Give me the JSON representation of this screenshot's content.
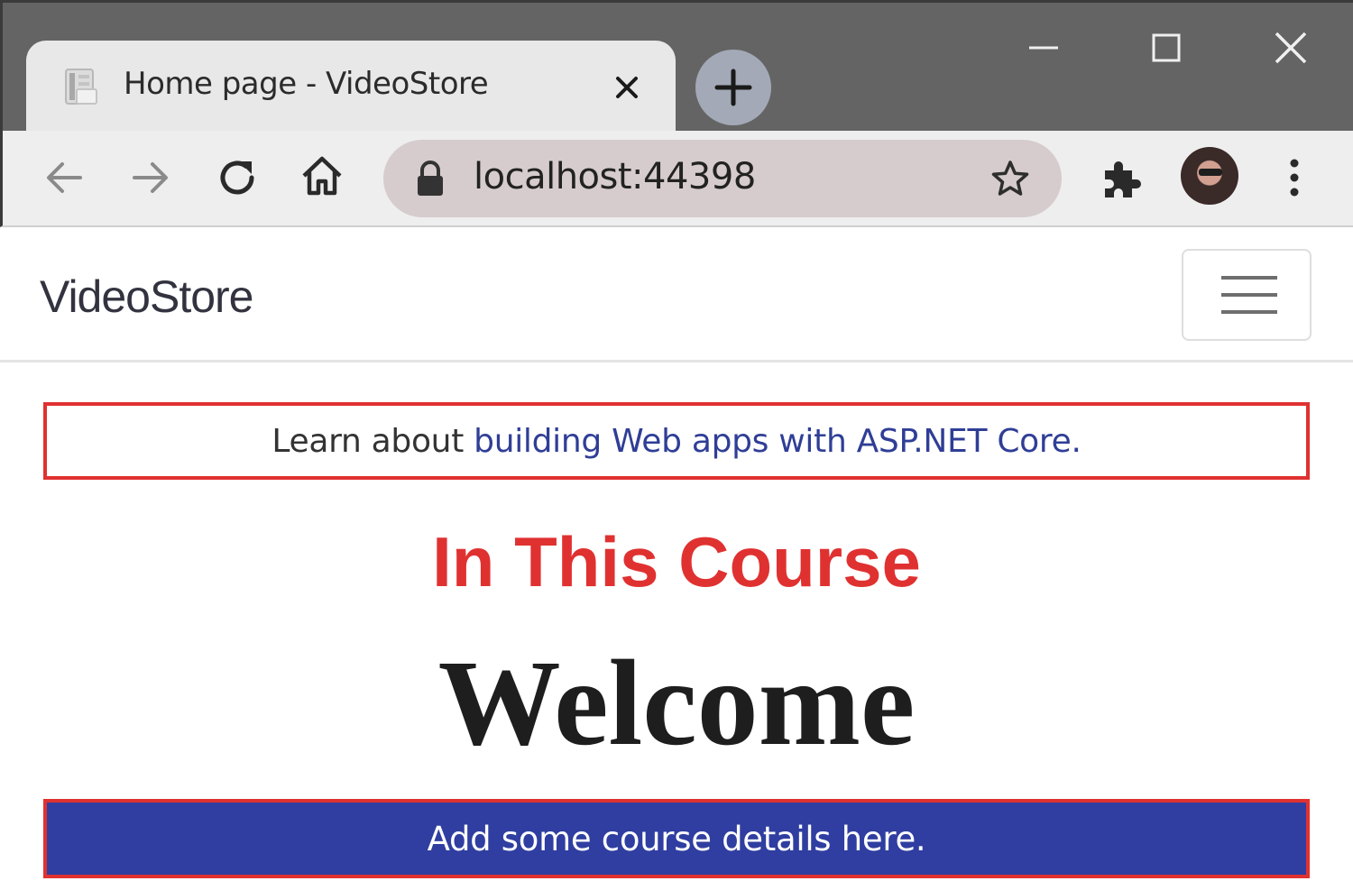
{
  "browser": {
    "tab": {
      "title": "Home page - VideoStore",
      "favicon": "page-icon",
      "close": "close-icon"
    },
    "new_tab": "plus-icon",
    "window_controls": [
      "minimize-icon",
      "maximize-icon",
      "close-icon"
    ],
    "toolbar": {
      "back": "arrow-left-icon",
      "forward": "arrow-right-icon",
      "reload": "reload-icon",
      "home": "home-icon",
      "url": "localhost:44398",
      "lock": "lock-icon",
      "bookmark": "star-icon",
      "extensions": "puzzle-icon",
      "profile": "avatar",
      "menu": "more-vertical-icon"
    }
  },
  "navbar": {
    "brand": "VideoStore",
    "toggler": "hamburger-icon"
  },
  "main": {
    "learn_prefix": "Learn about ",
    "learn_link": "building Web apps with ASP.NET Core.",
    "course_heading": "In This Course",
    "welcome": "Welcome",
    "details": "Add some course details here."
  },
  "colors": {
    "highlight_border": "#e03131",
    "heading_red": "#e03131",
    "details_bg": "#2f3ea0",
    "link": "#2f3e96",
    "omnibox": "#d6cccd",
    "titlebar": "#646464"
  }
}
